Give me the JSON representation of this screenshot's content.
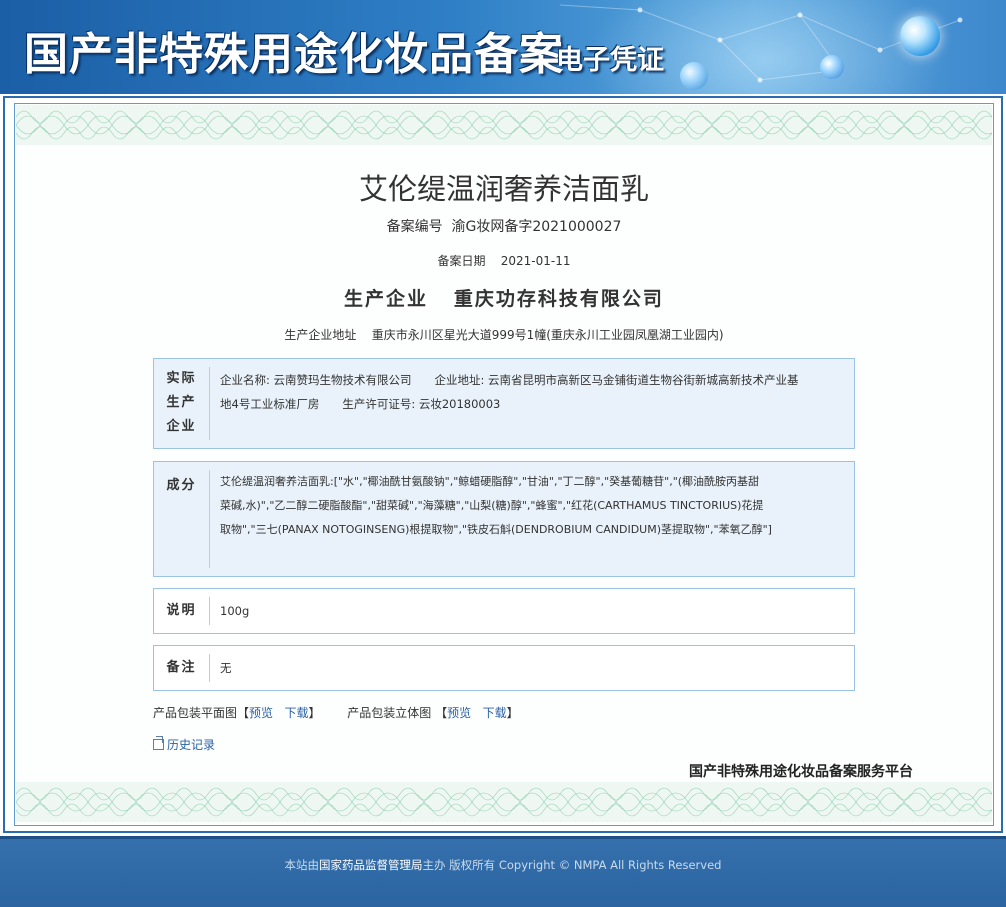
{
  "header": {
    "title": "国产非特殊用途化妆品备案",
    "subtitle": "电子凭证"
  },
  "certificate": {
    "product_name": "艾伦缇温润奢养洁面乳",
    "reg_no_label": "备案编号",
    "reg_no": "渝G妆网备字2021000027",
    "date_label": "备案日期",
    "date": "2021-01-11",
    "company_label": "生产企业",
    "company": "重庆功存科技有限公司",
    "address_label": "生产企业地址",
    "address": "重庆市永川区星光大道999号1幢(重庆永川工业园凤凰湖工业园内)"
  },
  "actual_maker": {
    "label": [
      "实际",
      "生产",
      "企业"
    ],
    "line1": "企业名称: 云南赞玛生物技术有限公司　　企业地址: 云南省昆明市高新区马金铺街道生物谷街新城高新技术产业基",
    "line2": "地4号工业标准厂房　　生产许可证号: 云妆20180003"
  },
  "ingredients": {
    "label": "成分",
    "line1": "艾伦缇温润奢养洁面乳:[\"水\",\"椰油酰甘氨酸钠\",\"鲸蜡硬脂醇\",\"甘油\",\"丁二醇\",\"癸基葡糖苷\",\"(椰油酰胺丙基甜",
    "line2": "菜碱,水)\",\"乙二醇二硬脂酸酯\",\"甜菜碱\",\"海藻糖\",\"山梨(糖)醇\",\"蜂蜜\",\"红花(CARTHAMUS TINCTORIUS)花提",
    "line3": "取物\",\"三七(PANAX NOTOGINSENG)根提取物\",\"铁皮石斛(DENDROBIUM CANDIDUM)茎提取物\",\"苯氧乙醇\"]"
  },
  "description": {
    "label": "说明",
    "value": "100g"
  },
  "remark": {
    "label": "备注",
    "value": "无"
  },
  "packaging": {
    "flat_label": "产品包装平面图",
    "solid_label": "产品包装立体图",
    "preview": "预览",
    "download": "下载",
    "open_bracket": "【",
    "close_bracket": "】"
  },
  "history_label": "历史记录",
  "platform": "国产非特殊用途化妆品备案服务平台",
  "footer": {
    "prefix": "本站由",
    "org": "国家药品监督管理局",
    "suffix": "主办 版权所有 Copyright © NMPA All Rights Reserved"
  },
  "colors": {
    "header_blue": "#2f7fc6",
    "frame_blue": "#2b6cb0",
    "link_blue": "#2a62a8",
    "box_fill": "#e9f2fa",
    "footer_blue": "#2b64a0"
  }
}
